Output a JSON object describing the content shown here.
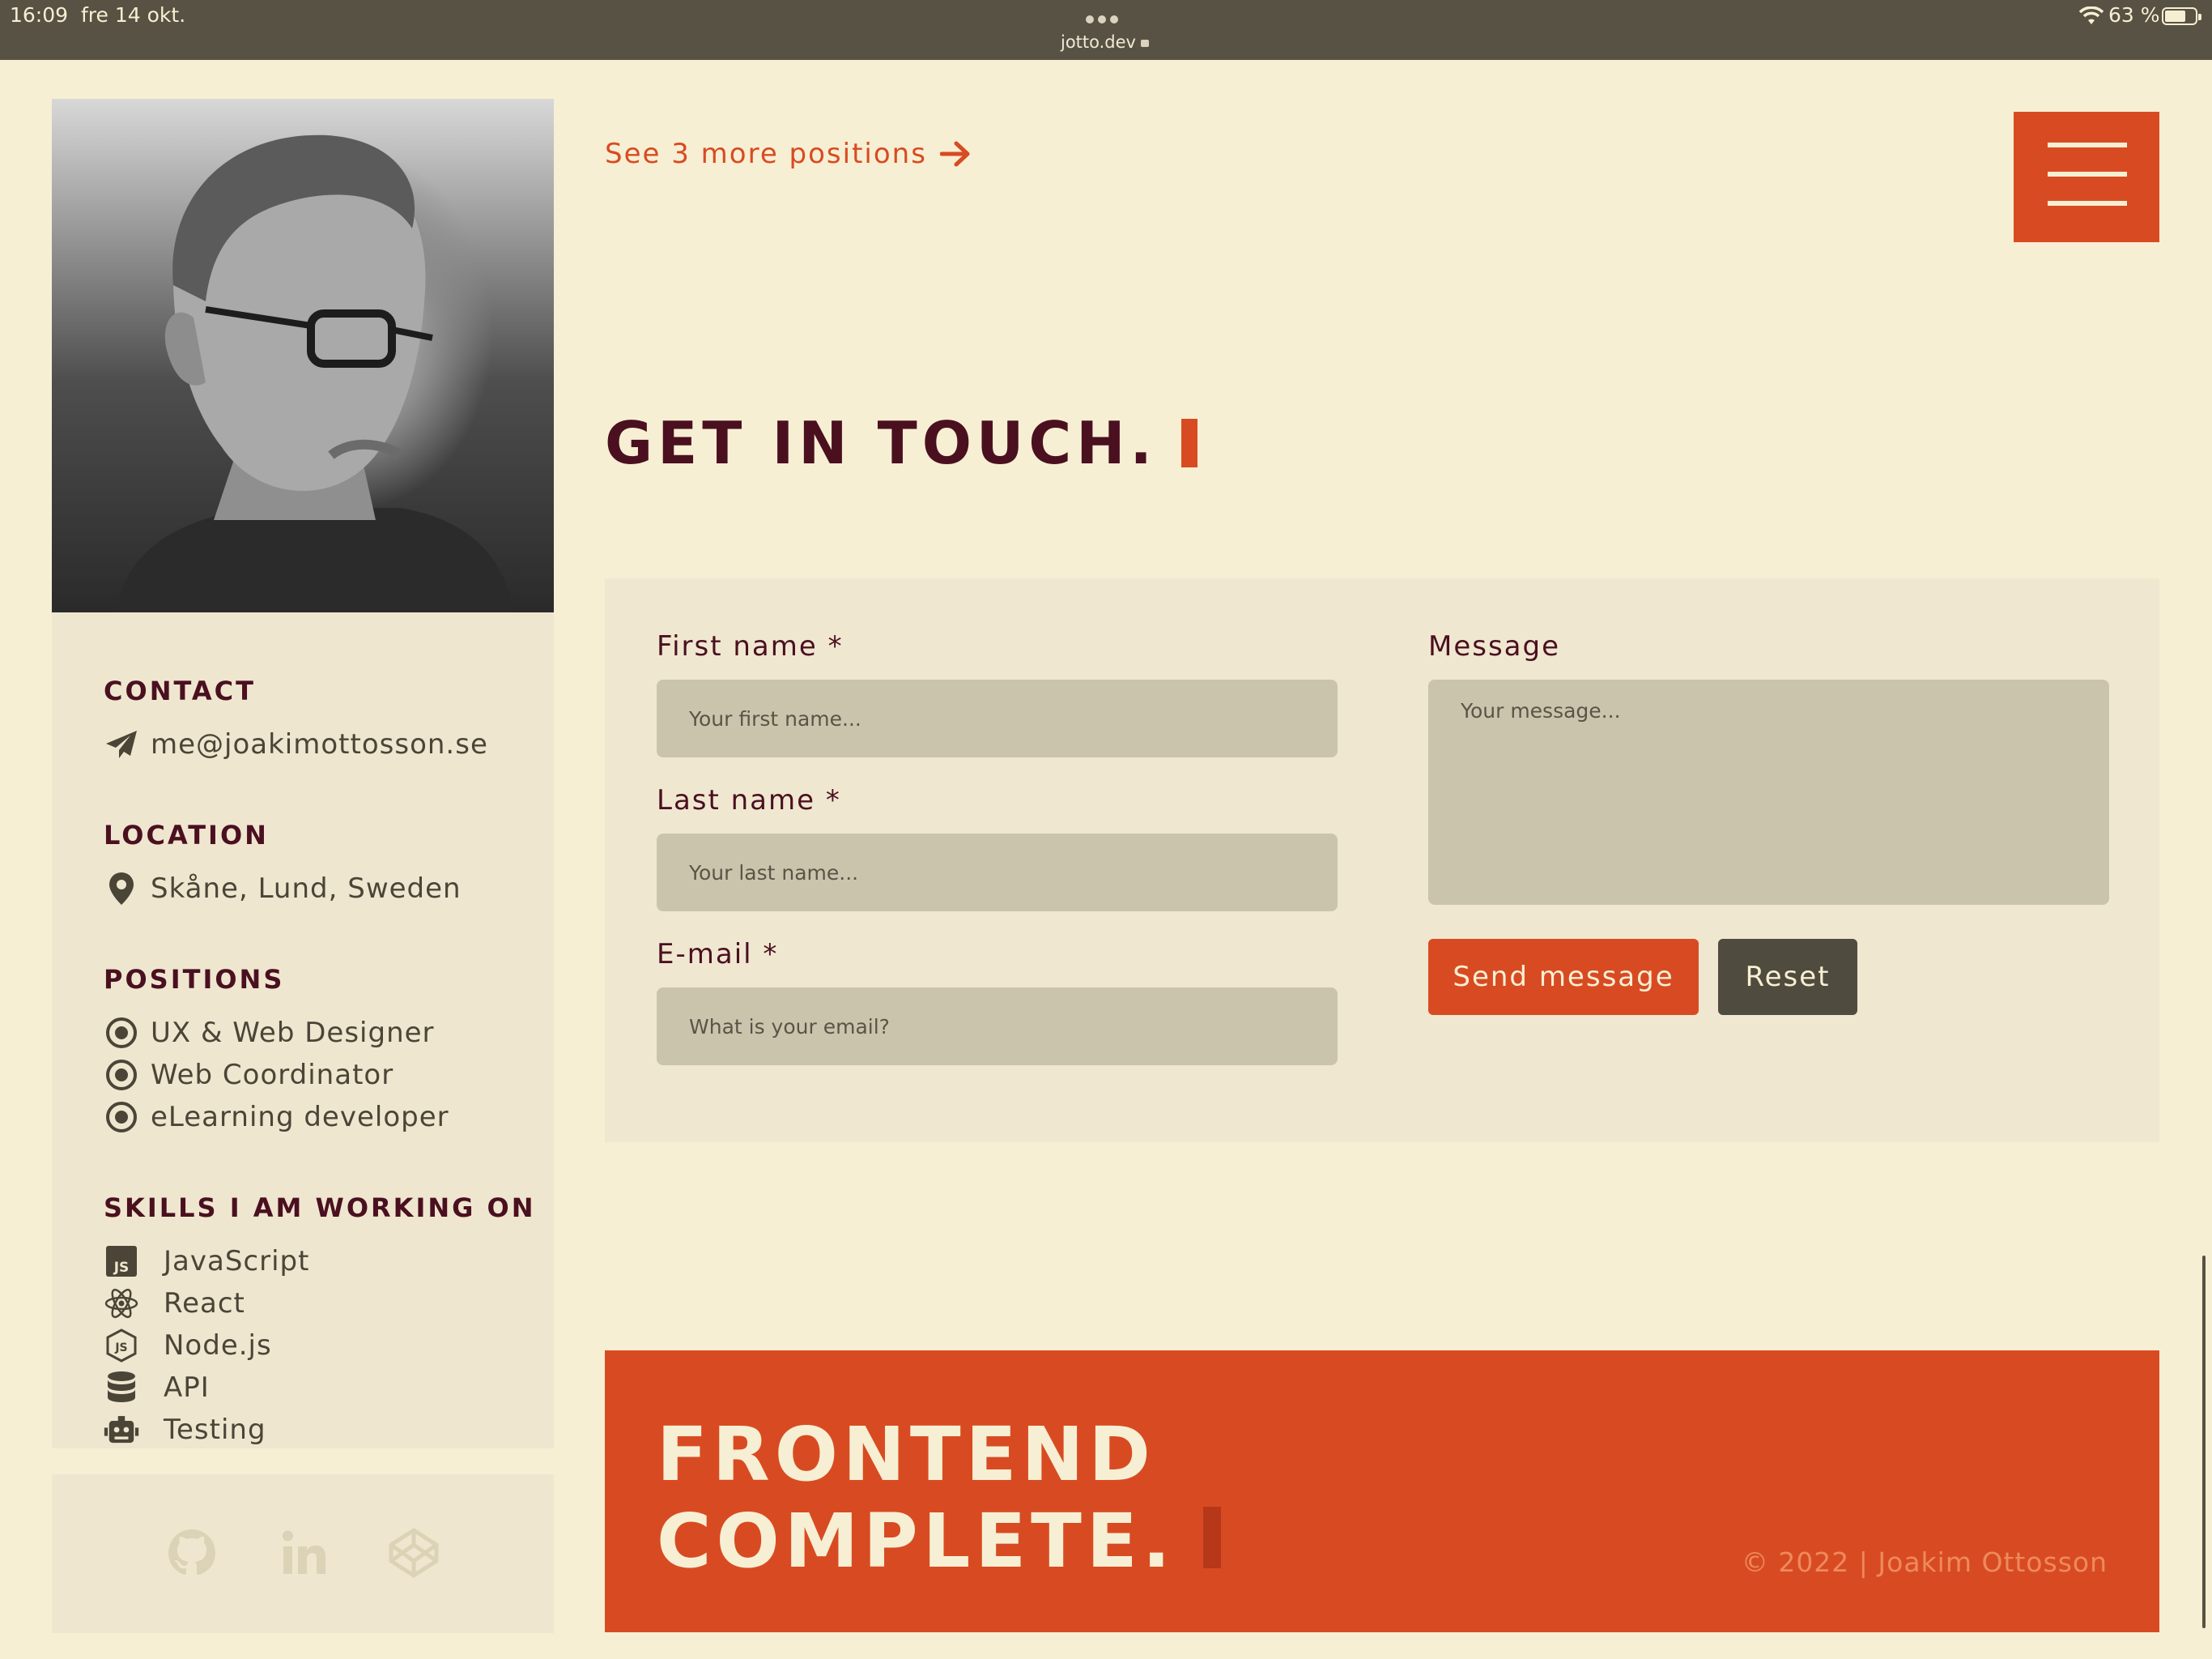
{
  "status_bar": {
    "time": "16:09",
    "date": "fre 14 okt.",
    "url": "jotto.dev",
    "battery": "63 %"
  },
  "sidebar": {
    "contact": {
      "heading": "CONTACT",
      "email": "me@joakimottosson.se"
    },
    "location": {
      "heading": "LOCATION",
      "value": "Skåne, Lund, Sweden"
    },
    "positions": {
      "heading": "POSITIONS",
      "items": [
        "UX & Web Designer",
        "Web Coordinator",
        "eLearning developer"
      ]
    },
    "skills": {
      "heading": "SKILLS I AM WORKING ON",
      "items": [
        {
          "label": "JavaScript",
          "icon": "javascript-icon"
        },
        {
          "label": "React",
          "icon": "react-icon"
        },
        {
          "label": "Node.js",
          "icon": "nodejs-icon"
        },
        {
          "label": "API",
          "icon": "database-icon"
        },
        {
          "label": "Testing",
          "icon": "robot-icon"
        }
      ]
    },
    "social": [
      "github-icon",
      "linkedin-icon",
      "codepen-icon"
    ]
  },
  "main": {
    "more_link": "See 3 more positions",
    "heading": "GET IN TOUCH.",
    "form": {
      "first_name_label": "First name *",
      "first_name_placeholder": "Your first name...",
      "last_name_label": "Last name *",
      "last_name_placeholder": "Your last name...",
      "email_label": "E-mail *",
      "email_placeholder": "What is your email?",
      "message_label": "Message",
      "message_placeholder": "Your message...",
      "send_label": "Send message",
      "reset_label": "Reset"
    },
    "footer": {
      "line1": "FRONTEND",
      "line2": "COMPLETE.",
      "copyright": "© 2022 | Joakim Ottosson"
    }
  },
  "colors": {
    "background": "#f7efd3",
    "accent": "#d84b22",
    "heading": "#4a1020",
    "card": "#efe6cf",
    "field": "#cbc4ad",
    "dark_button": "#4f4b3e"
  }
}
